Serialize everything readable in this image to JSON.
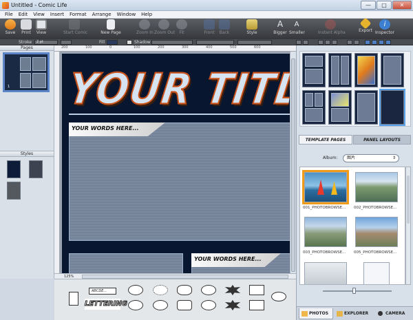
{
  "window": {
    "title": "Untitled - Comic Life",
    "min": "—",
    "max": "□",
    "close": "✕"
  },
  "menu": [
    "File",
    "Edit",
    "View",
    "Insert",
    "Format",
    "Arrange",
    "Window",
    "Help"
  ],
  "toolbar": {
    "save": "Save",
    "print": "Print",
    "view": "View",
    "start_comic": "Start Comic",
    "new_page": "New Page",
    "zoom_in": "Zoom In",
    "zoom_out": "Zoom Out",
    "fit": "Fit",
    "front": "Front",
    "back": "Back",
    "style": "Style",
    "bigger": "Bigger",
    "smaller": "Smaller",
    "instant_alpha": "Instant Alpha",
    "export": "Export",
    "inspector": "Inspector"
  },
  "format_bar": {
    "stroke_label": "Stroke",
    "stroke_value": "2 pt",
    "fill_label": "Fill",
    "shadow_label": "Shadow"
  },
  "left_panel": {
    "pages_header": "Pages",
    "styles_header": "Styles",
    "page_number": "1"
  },
  "ruler": {
    "marks": [
      "200",
      "100",
      "0",
      "100",
      "200",
      "300",
      "400",
      "500",
      "600"
    ]
  },
  "canvas": {
    "title_text": "YOUR TITLE HERE",
    "caption_1": "YOUR WORDS HERE...",
    "caption_2": "YOUR WORDS HERE..."
  },
  "zoom": {
    "level": "125%"
  },
  "shelf": {
    "caption_sample": "ABCDE...",
    "lettering_sample": "LETTERING"
  },
  "right_panel": {
    "tabs": {
      "templates": "TEMPLATE PAGES",
      "layouts": "PANEL LAYOUTS"
    },
    "album_label": "Album:",
    "album_value": "图片",
    "photos": [
      {
        "caption": "001_PHOTOBROWSE..."
      },
      {
        "caption": "002_PHOTOBROWSE..."
      },
      {
        "caption": "003_PHOTOBROWSE..."
      },
      {
        "caption": "005_PHOTOBROWSE..."
      }
    ],
    "bottom_tabs": {
      "photos": "PHOTOS",
      "explorer": "EXPLORER",
      "camera": "CAMERA"
    }
  },
  "colors": {
    "toolbar_bg": "#3f4246",
    "page_bg": "#08162f",
    "title_outline": "#c8531d",
    "selection": "#f09a1a"
  }
}
